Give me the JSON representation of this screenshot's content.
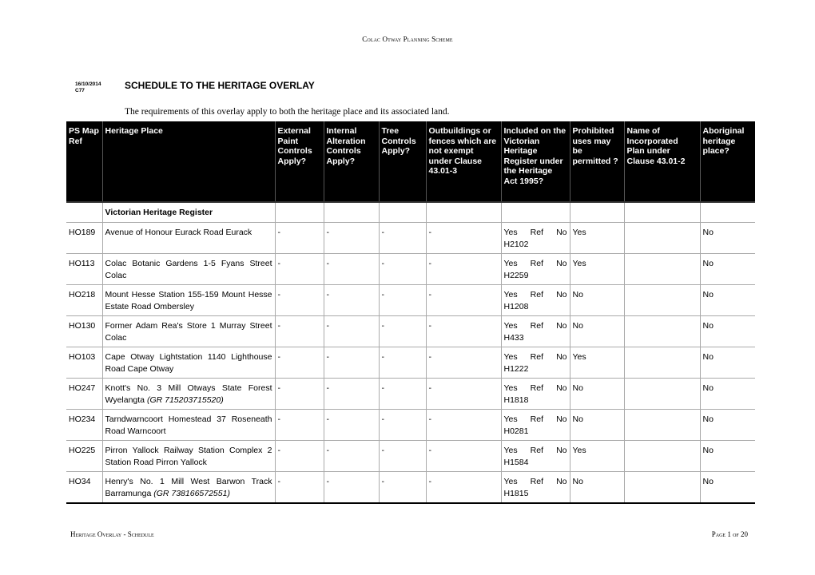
{
  "running_head": "Colac Otway Planning Scheme",
  "date": "16/10/2014",
  "amendment": "C77",
  "title": "SCHEDULE TO THE HERITAGE OVERLAY",
  "intro": "The requirements of this overlay apply to both the heritage place and its associated land.",
  "table": {
    "headers": [
      "PS Map Ref",
      "Heritage Place",
      "External Paint Controls Apply?",
      "Internal Alteration Controls Apply?",
      "Tree Controls Apply?",
      "Outbuildings or fences which are not exempt under Clause 43.01-3",
      "Included on the Victorian Heritage Register under the Heritage Act 1995?",
      "Prohibited uses may be permitted ?",
      "Name of Incorporated Plan under Clause 43.01-2",
      "Aboriginal heritage place?"
    ],
    "section_label": "Victorian Heritage Register",
    "rows": [
      {
        "ref": "HO189",
        "place": "Avenue of Honour Eurack Road Eurack",
        "gr": "",
        "paint": "-",
        "internal": "-",
        "tree": "-",
        "outbuildings": "-",
        "vhr": "Yes Ref No H2102",
        "prohibited": "Yes",
        "plan": "",
        "aboriginal": "No"
      },
      {
        "ref": "HO113",
        "place": "Colac Botanic Gardens 1-5 Fyans Street Colac",
        "gr": "",
        "paint": "-",
        "internal": "-",
        "tree": "-",
        "outbuildings": "-",
        "vhr": "Yes Ref No H2259",
        "prohibited": "Yes",
        "plan": "",
        "aboriginal": "No"
      },
      {
        "ref": "HO218",
        "place": "Mount Hesse Station 155-159 Mount Hesse Estate Road Ombersley",
        "gr": "",
        "paint": "-",
        "internal": "-",
        "tree": "-",
        "outbuildings": "-",
        "vhr": "Yes Ref No H1208",
        "prohibited": "No",
        "plan": "",
        "aboriginal": "No"
      },
      {
        "ref": "HO130",
        "place": "Former Adam Rea's Store 1 Murray Street Colac",
        "gr": "",
        "paint": "-",
        "internal": "-",
        "tree": "-",
        "outbuildings": "-",
        "vhr": "Yes Ref No H433",
        "prohibited": "No",
        "plan": "",
        "aboriginal": "No"
      },
      {
        "ref": "HO103",
        "place": "Cape Otway Lightstation 1140 Lighthouse Road Cape Otway",
        "gr": "",
        "paint": "-",
        "internal": "-",
        "tree": "-",
        "outbuildings": "-",
        "vhr": "Yes Ref No H1222",
        "prohibited": "Yes",
        "plan": "",
        "aboriginal": "No"
      },
      {
        "ref": "HO247",
        "place": "Knott's No. 3 Mill Otways State Forest Wyelangta",
        "gr": "(GR 715203715520)",
        "paint": "-",
        "internal": "-",
        "tree": "-",
        "outbuildings": "-",
        "vhr": "Yes Ref No H1818",
        "prohibited": "No",
        "plan": "",
        "aboriginal": "No"
      },
      {
        "ref": "HO234",
        "place": "Tarndwarncoort Homestead 37 Roseneath Road Warncoort",
        "gr": "",
        "paint": "-",
        "internal": "-",
        "tree": "-",
        "outbuildings": "-",
        "vhr": "Yes Ref No H0281",
        "prohibited": "No",
        "plan": "",
        "aboriginal": "No"
      },
      {
        "ref": "HO225",
        "place": "Pirron Yallock Railway Station Complex 2 Station Road Pirron Yallock",
        "gr": "",
        "paint": "-",
        "internal": "-",
        "tree": "-",
        "outbuildings": "-",
        "vhr": "Yes Ref No H1584",
        "prohibited": "Yes",
        "plan": "",
        "aboriginal": "No"
      },
      {
        "ref": "HO34",
        "place": "Henry's No. 1 Mill West Barwon Track Barramunga",
        "gr": "(GR 738166572551)",
        "paint": "-",
        "internal": "-",
        "tree": "-",
        "outbuildings": "-",
        "vhr": "Yes Ref No H1815",
        "prohibited": "No",
        "plan": "",
        "aboriginal": "No"
      }
    ]
  },
  "footer": {
    "left": "Heritage Overlay - Schedule",
    "right": "Page 1 of 20"
  }
}
